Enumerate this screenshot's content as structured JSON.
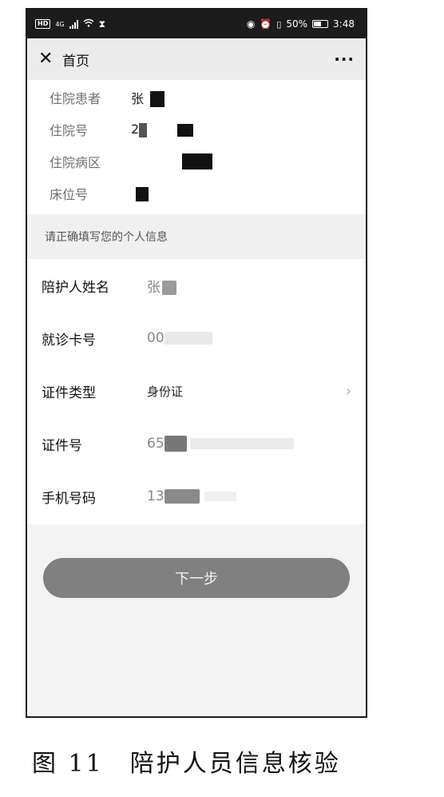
{
  "status_bar": {
    "network": "HD",
    "signal_type": "4G",
    "battery": "50%",
    "time": "3:48"
  },
  "header": {
    "title": "首页"
  },
  "patient_info": [
    {
      "label": "住院患者",
      "value": "张"
    },
    {
      "label": "住院号",
      "value": "2"
    },
    {
      "label": "住院病区",
      "value": ""
    },
    {
      "label": "床位号",
      "value": ""
    }
  ],
  "hint": "请正确填写您的个人信息",
  "form": [
    {
      "label": "陪护人姓名",
      "value": "张"
    },
    {
      "label": "就诊卡号",
      "value": "00"
    },
    {
      "label": "证件类型",
      "value": "身份证"
    },
    {
      "label": "证件号",
      "value": "65"
    },
    {
      "label": "手机号码",
      "value": "13"
    }
  ],
  "next_button": "下一步",
  "caption": "图 11　陪护人员信息核验"
}
